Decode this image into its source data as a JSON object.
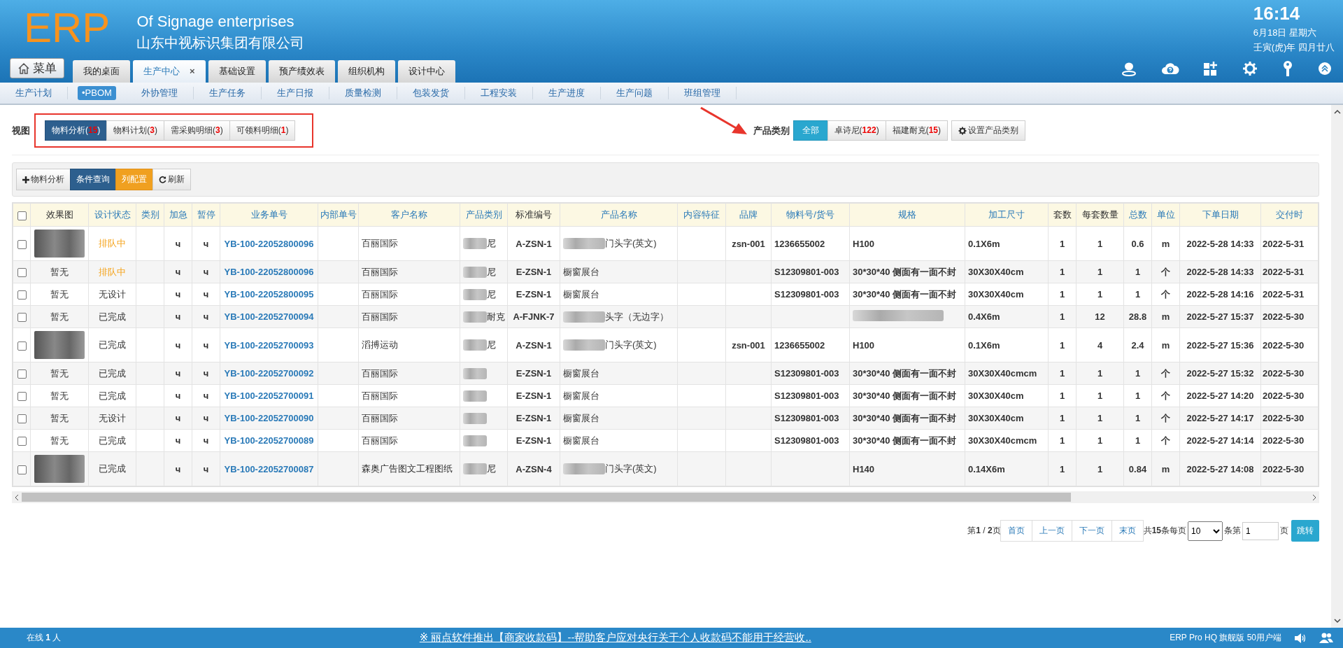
{
  "header": {
    "logo": "ERP",
    "company_en": "Of Signage enterprises",
    "company_cn": "山东中视标识集团有限公司",
    "time": "16:14",
    "date": "6月18日 星期六",
    "lunar": "壬寅(虎)年 四月廿八"
  },
  "menu_button": "菜单",
  "tabs": [
    {
      "label": "我的桌面",
      "selected": false
    },
    {
      "label": "生产中心",
      "selected": true,
      "close": "×"
    },
    {
      "label": "基础设置",
      "selected": false
    },
    {
      "label": "预产绩效表",
      "selected": false
    },
    {
      "label": "组织机构",
      "selected": false
    },
    {
      "label": "设计中心",
      "selected": false
    }
  ],
  "subnav": [
    {
      "label": "生产计划",
      "selected": false
    },
    {
      "label": "•PBOM",
      "selected": true
    },
    {
      "label": "外协管理",
      "selected": false
    },
    {
      "label": "生产任务",
      "selected": false
    },
    {
      "label": "生产日报",
      "selected": false
    },
    {
      "label": "质量检测",
      "selected": false
    },
    {
      "label": "包装发货",
      "selected": false
    },
    {
      "label": "工程安装",
      "selected": false
    },
    {
      "label": "生产进度",
      "selected": false
    },
    {
      "label": "生产问题",
      "selected": false
    },
    {
      "label": "班组管理",
      "selected": false
    }
  ],
  "view": {
    "label": "视图",
    "options": [
      {
        "label": "物料分析(**15**)",
        "selected": true
      },
      {
        "label": "物料计划(**3**)",
        "selected": false
      },
      {
        "label": "需采购明细(**3**)",
        "selected": false
      },
      {
        "label": "可领料明细(**1**)",
        "selected": false
      }
    ]
  },
  "category": {
    "label": "产品类别",
    "options": [
      {
        "label": "全部",
        "selected": true
      },
      {
        "label": "卓诗尼(**122**)",
        "selected": false
      },
      {
        "label": "福建耐克(**15**)",
        "selected": false
      }
    ],
    "settings_button": "设置产品类别"
  },
  "toolbar": [
    {
      "label": "物料分析",
      "kind": "add"
    },
    {
      "label": "条件查询",
      "kind": "primary"
    },
    {
      "label": "列配置",
      "kind": "warning"
    },
    {
      "label": "刷新",
      "kind": "refresh"
    }
  ],
  "table": {
    "select_all_checked": false,
    "columns": [
      {
        "label": "效果图",
        "sortable": false
      },
      {
        "label": "设计状态",
        "sortable": true
      },
      {
        "label": "类别",
        "sortable": true
      },
      {
        "label": "加急",
        "sortable": true
      },
      {
        "label": "暂停",
        "sortable": true
      },
      {
        "label": "业务单号",
        "sortable": true
      },
      {
        "label": "内部单号",
        "sortable": true
      },
      {
        "label": "客户名称",
        "sortable": true
      },
      {
        "label": "产品类别",
        "sortable": true
      },
      {
        "label": "标准编号",
        "sortable": false
      },
      {
        "label": "产品名称",
        "sortable": true
      },
      {
        "label": "内容特征",
        "sortable": true
      },
      {
        "label": "品牌",
        "sortable": true
      },
      {
        "label": "物料号/货号",
        "sortable": true
      },
      {
        "label": "规格",
        "sortable": true
      },
      {
        "label": "加工尺寸",
        "sortable": true
      },
      {
        "label": "套数",
        "sortable": false
      },
      {
        "label": "每套数量",
        "sortable": false
      },
      {
        "label": "总数",
        "sortable": true
      },
      {
        "label": "单位",
        "sortable": true
      },
      {
        "label": "下单日期",
        "sortable": true
      },
      {
        "label": "交付时",
        "sortable": true
      }
    ],
    "rows": [
      {
        "checked": false,
        "image": {
          "kind": "photo"
        },
        "status": {
          "text": "排队中",
          "kind": "queued"
        },
        "urgent": "ч",
        "paused": "ч",
        "order_no": "YB-100-22052800096",
        "customer": "百丽国际",
        "product_category": "尼",
        "standard_no": "A-ZSN-1",
        "product_name": "门头字(英文)",
        "product_name_blurred": true,
        "brand": "zsn-001",
        "material_no": "1236655002",
        "spec": "H100",
        "spec_blurred": false,
        "size": "0.1X6m",
        "sets": "1",
        "per_set": "1",
        "total": "0.6",
        "unit": "m",
        "order_date": "2022-5-28 14:33",
        "delivery": "2022-5-31"
      },
      {
        "checked": false,
        "image": {
          "kind": "none",
          "text": "暂无"
        },
        "status": {
          "text": "排队中",
          "kind": "queued"
        },
        "urgent": "ч",
        "paused": "ч",
        "order_no": "YB-100-22052800096",
        "customer": "百丽国际",
        "product_category": "尼",
        "standard_no": "E-ZSN-1",
        "product_name": "橱窗展台",
        "product_name_blurred": false,
        "material_no": "S12309801-003",
        "spec": "30*30*40 侧面有一面不封",
        "spec_blurred": false,
        "size": "30X30X40cm",
        "sets": "1",
        "per_set": "1",
        "total": "1",
        "unit": "个",
        "order_date": "2022-5-28 14:33",
        "delivery": "2022-5-31"
      },
      {
        "checked": false,
        "image": {
          "kind": "none",
          "text": "暂无"
        },
        "status": {
          "text": "无设计",
          "kind": "normal"
        },
        "urgent": "ч",
        "paused": "ч",
        "order_no": "YB-100-22052800095",
        "customer": "百丽国际",
        "product_category": "尼",
        "standard_no": "E-ZSN-1",
        "product_name": "橱窗展台",
        "product_name_blurred": false,
        "material_no": "S12309801-003",
        "spec": "30*30*40 侧面有一面不封",
        "spec_blurred": false,
        "size": "30X30X40cm",
        "sets": "1",
        "per_set": "1",
        "total": "1",
        "unit": "个",
        "order_date": "2022-5-28 14:16",
        "delivery": "2022-5-31"
      },
      {
        "checked": false,
        "image": {
          "kind": "none",
          "text": "暂无"
        },
        "status": {
          "text": "已完成",
          "kind": "normal"
        },
        "urgent": "ч",
        "paused": "ч",
        "order_no": "YB-100-22052700094",
        "customer": "百丽国际",
        "product_category": "耐克",
        "standard_no": "A-FJNK-7",
        "product_name": "头字（无边字）",
        "product_name_blurred": true,
        "spec_blurred": true,
        "size": "0.4X6m",
        "sets": "1",
        "per_set": "12",
        "total": "28.8",
        "unit": "m",
        "order_date": "2022-5-27 15:37",
        "delivery": "2022-5-30"
      },
      {
        "checked": false,
        "image": {
          "kind": "photo"
        },
        "status": {
          "text": "已完成",
          "kind": "normal"
        },
        "urgent": "ч",
        "paused": "ч",
        "order_no": "YB-100-22052700093",
        "customer": "滔搏运动",
        "product_category": "尼",
        "standard_no": "A-ZSN-1",
        "product_name": "门头字(英文)",
        "product_name_blurred": true,
        "brand": "zsn-001",
        "material_no": "1236655002",
        "spec": "H100",
        "spec_blurred": false,
        "size": "0.1X6m",
        "sets": "1",
        "per_set": "4",
        "total": "2.4",
        "unit": "m",
        "order_date": "2022-5-27 15:36",
        "delivery": "2022-5-30"
      },
      {
        "checked": false,
        "image": {
          "kind": "none",
          "text": "暂无"
        },
        "status": {
          "text": "已完成",
          "kind": "normal"
        },
        "urgent": "ч",
        "paused": "ч",
        "order_no": "YB-100-22052700092",
        "customer": "百丽国际",
        "standard_no": "E-ZSN-1",
        "product_name": "橱窗展台",
        "product_name_blurred": false,
        "material_no": "S12309801-003",
        "spec": "30*30*40 侧面有一面不封",
        "spec_blurred": false,
        "size": "30X30X40cmcm",
        "sets": "1",
        "per_set": "1",
        "total": "1",
        "unit": "个",
        "order_date": "2022-5-27 15:32",
        "delivery": "2022-5-30"
      },
      {
        "checked": false,
        "image": {
          "kind": "none",
          "text": "暂无"
        },
        "status": {
          "text": "已完成",
          "kind": "normal"
        },
        "urgent": "ч",
        "paused": "ч",
        "order_no": "YB-100-22052700091",
        "customer": "百丽国际",
        "standard_no": "E-ZSN-1",
        "product_name": "橱窗展台",
        "product_name_blurred": false,
        "material_no": "S12309801-003",
        "spec": "30*30*40 侧面有一面不封",
        "spec_blurred": false,
        "size": "30X30X40cm",
        "sets": "1",
        "per_set": "1",
        "total": "1",
        "unit": "个",
        "order_date": "2022-5-27 14:20",
        "delivery": "2022-5-30"
      },
      {
        "checked": false,
        "image": {
          "kind": "none",
          "text": "暂无"
        },
        "status": {
          "text": "无设计",
          "kind": "normal"
        },
        "urgent": "ч",
        "paused": "ч",
        "order_no": "YB-100-22052700090",
        "customer": "百丽国际",
        "standard_no": "E-ZSN-1",
        "product_name": "橱窗展台",
        "product_name_blurred": false,
        "material_no": "S12309801-003",
        "spec": "30*30*40 侧面有一面不封",
        "spec_blurred": false,
        "size": "30X30X40cm",
        "sets": "1",
        "per_set": "1",
        "total": "1",
        "unit": "个",
        "order_date": "2022-5-27 14:17",
        "delivery": "2022-5-30"
      },
      {
        "checked": false,
        "image": {
          "kind": "none",
          "text": "暂无"
        },
        "status": {
          "text": "已完成",
          "kind": "normal"
        },
        "urgent": "ч",
        "paused": "ч",
        "order_no": "YB-100-22052700089",
        "customer": "百丽国际",
        "standard_no": "E-ZSN-1",
        "product_name": "橱窗展台",
        "product_name_blurred": false,
        "material_no": "S12309801-003",
        "spec": "30*30*40 侧面有一面不封",
        "spec_blurred": false,
        "size": "30X30X40cmcm",
        "sets": "1",
        "per_set": "1",
        "total": "1",
        "unit": "个",
        "order_date": "2022-5-27 14:14",
        "delivery": "2022-5-30"
      },
      {
        "checked": false,
        "image": {
          "kind": "photo"
        },
        "status": {
          "text": "已完成",
          "kind": "normal"
        },
        "urgent": "ч",
        "paused": "ч",
        "order_no": "YB-100-22052700087",
        "customer": "森奥广告图文工程图纸",
        "product_category": "尼",
        "standard_no": "A-ZSN-4",
        "product_name": "门头字(英文)",
        "product_name_blurred": true,
        "spec": "H140",
        "spec_blurred": false,
        "size": "0.14X6m",
        "sets": "1",
        "per_set": "1",
        "total": "0.84",
        "unit": "m",
        "order_date": "2022-5-27 14:08",
        "delivery": "2022-5-30"
      }
    ]
  },
  "pagination": {
    "page_info": "第**1** / **2**页",
    "buttons": [
      "首页",
      "上一页",
      "下一页",
      "末页"
    ],
    "total_text": "共**15**条每页",
    "page_size": "10",
    "goto_prefix": "条第",
    "goto_value": "1",
    "goto_suffix": "页",
    "goto_button": "跳转"
  },
  "footer": {
    "online": "在线 **1** 人",
    "notice": "※ 丽点软件推出【商家收款码】--帮助客户应对央行关于个人收款码不能用于经营收..",
    "edition": "ERP Pro HQ 旗舰版 50用户端"
  }
}
